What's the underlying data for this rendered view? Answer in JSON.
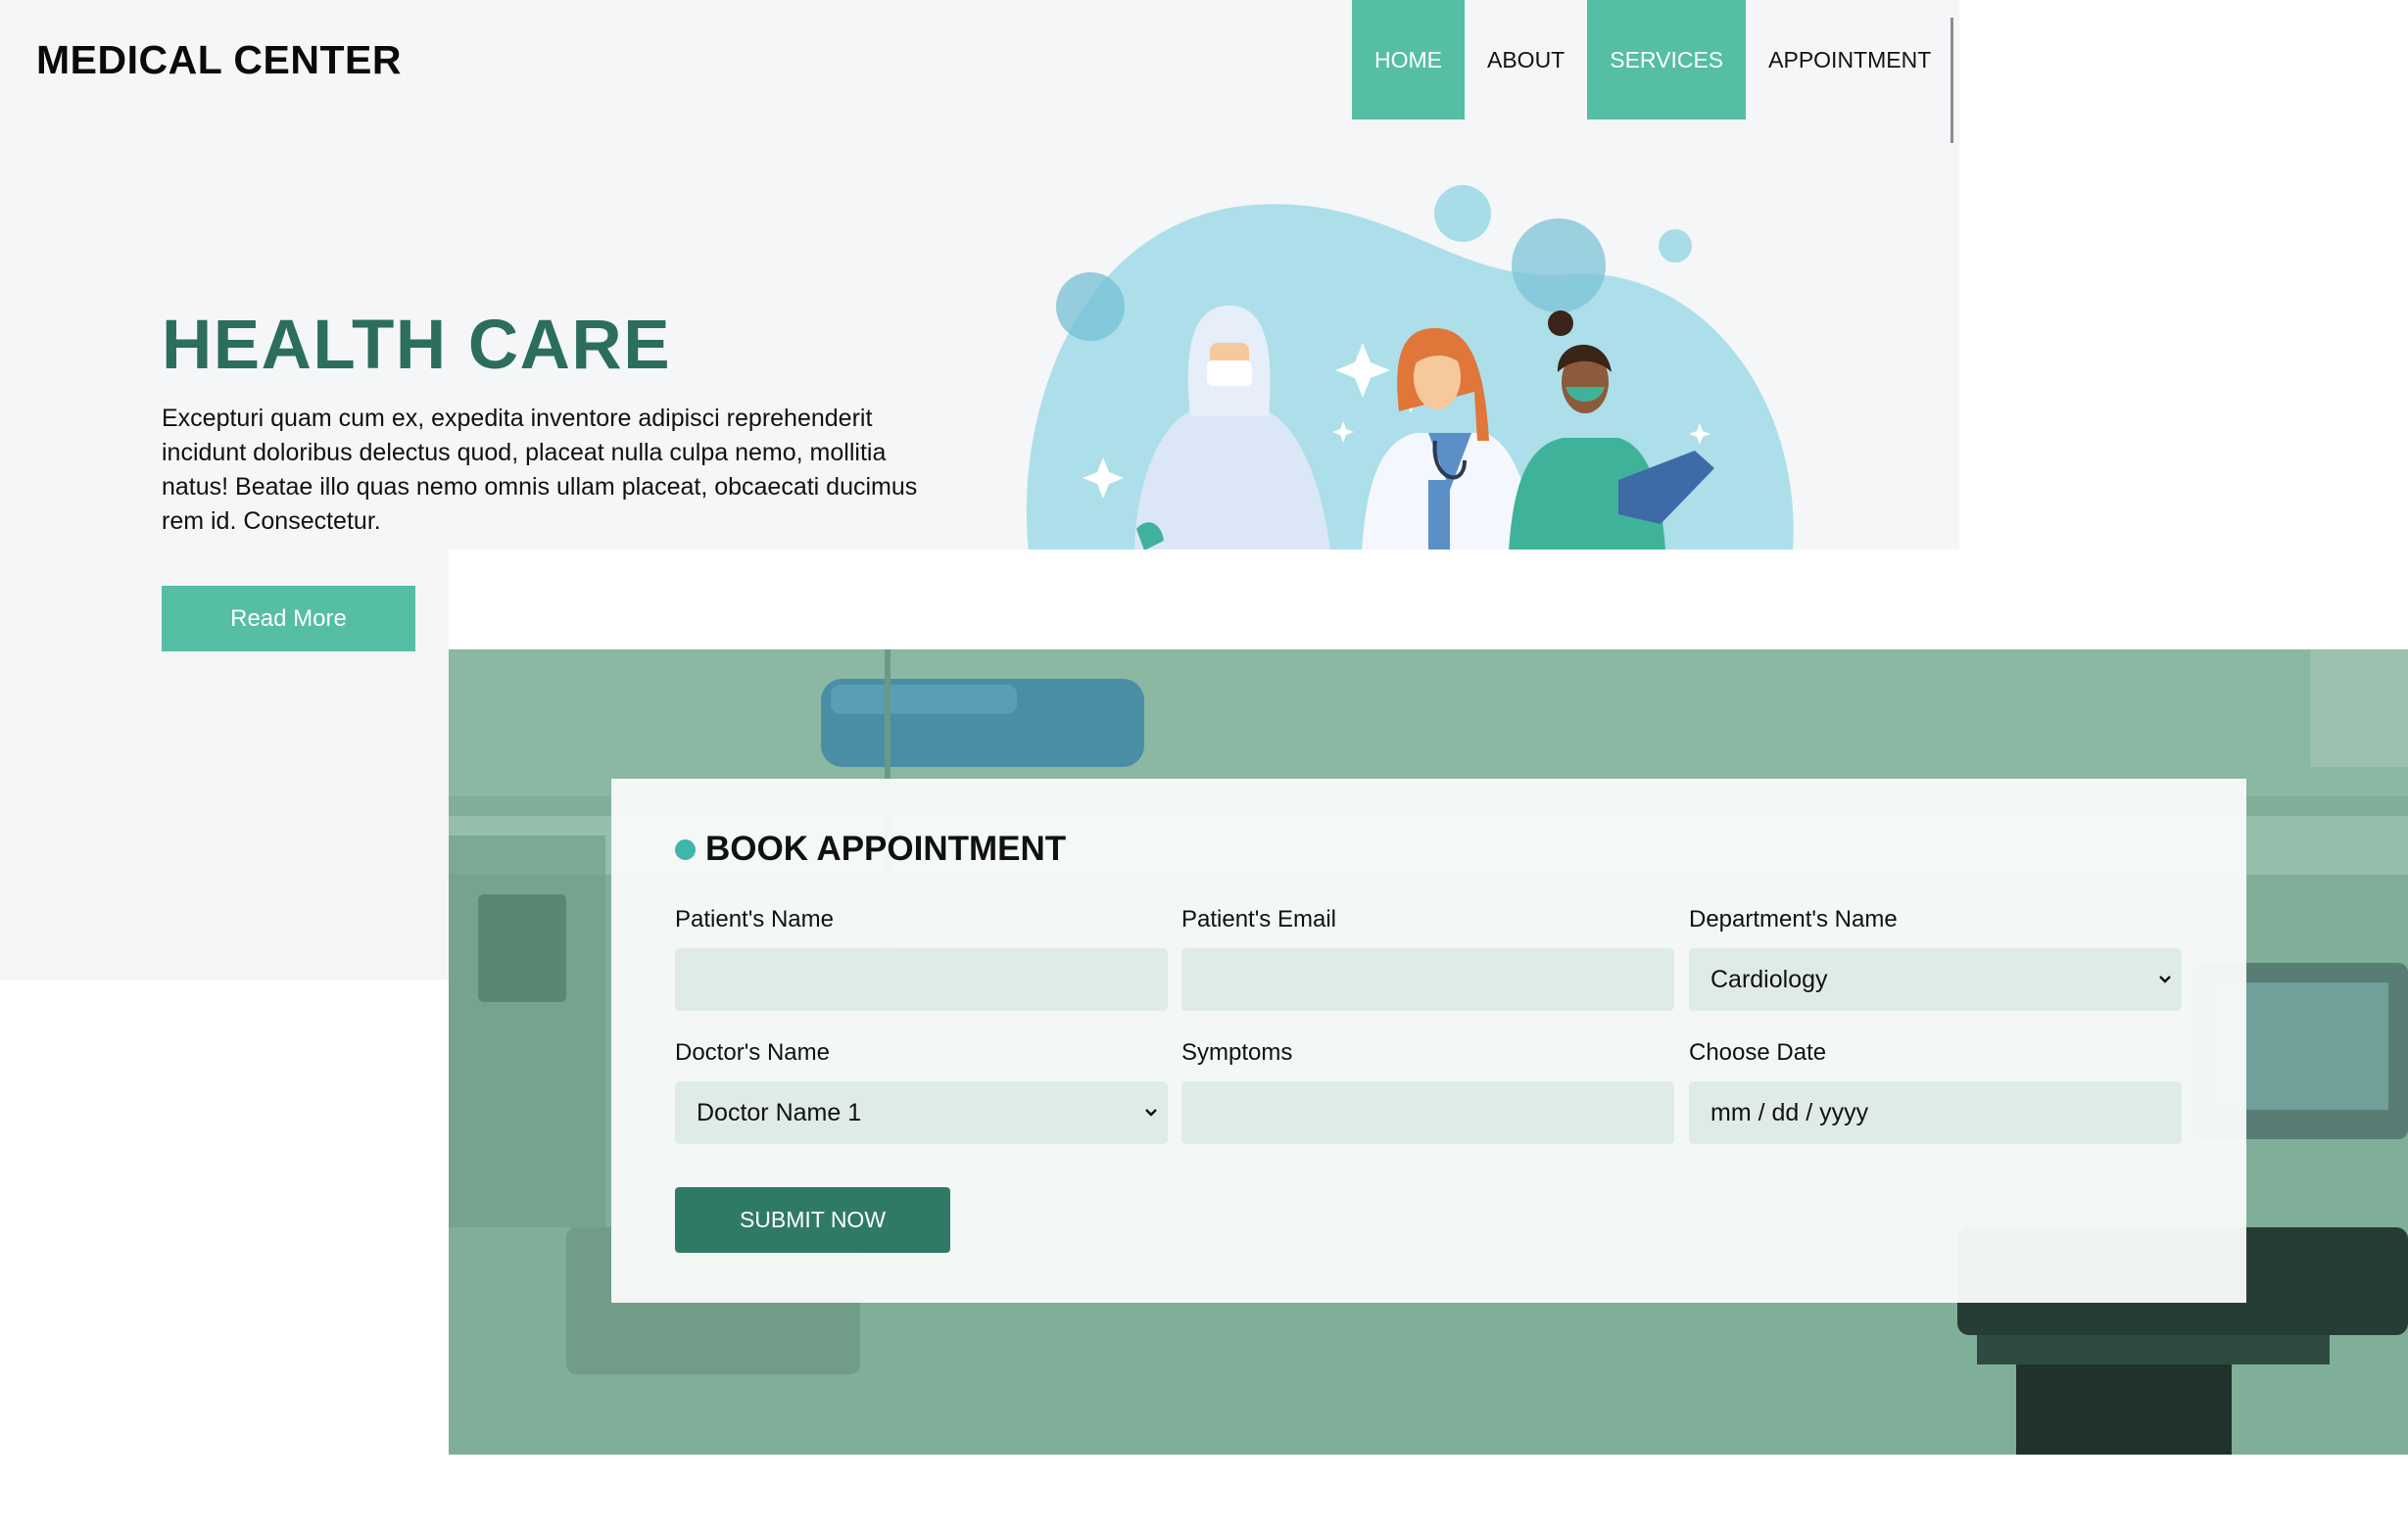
{
  "header": {
    "logo": "MEDICAL CENTER",
    "nav": [
      {
        "label": "HOME",
        "active": true
      },
      {
        "label": "ABOUT",
        "active": false
      },
      {
        "label": "SERVICES",
        "active": true
      },
      {
        "label": "APPOINTMENT",
        "active": false
      }
    ]
  },
  "hero": {
    "title": "HEALTH CARE",
    "text": "Excepturi quam cum ex, expedita inventore adipisci reprehenderit incidunt doloribus delectus quod, placeat nulla culpa nemo, mollitia natus! Beatae illo quas nemo omnis ullam placeat, obcaecati ducimus rem id. Consectetur.",
    "button": "Read More"
  },
  "appointment": {
    "title": "BOOK APPOINTMENT",
    "fields": {
      "patient_name": {
        "label": "Patient's Name",
        "value": ""
      },
      "patient_email": {
        "label": "Patient's Email",
        "value": ""
      },
      "department": {
        "label": "Department's Name",
        "value": "Cardiology"
      },
      "doctor": {
        "label": "Doctor's Name",
        "value": "Doctor Name 1"
      },
      "symptoms": {
        "label": "Symptoms",
        "value": ""
      },
      "date": {
        "label": "Choose Date",
        "placeholder": "mm / dd / yyyy"
      }
    },
    "submit": "SUBMIT NOW"
  },
  "colors": {
    "accent": "#55bea4",
    "heading": "#2c6e5d",
    "submit": "#2f7a66",
    "input_bg": "#dfebe7"
  }
}
